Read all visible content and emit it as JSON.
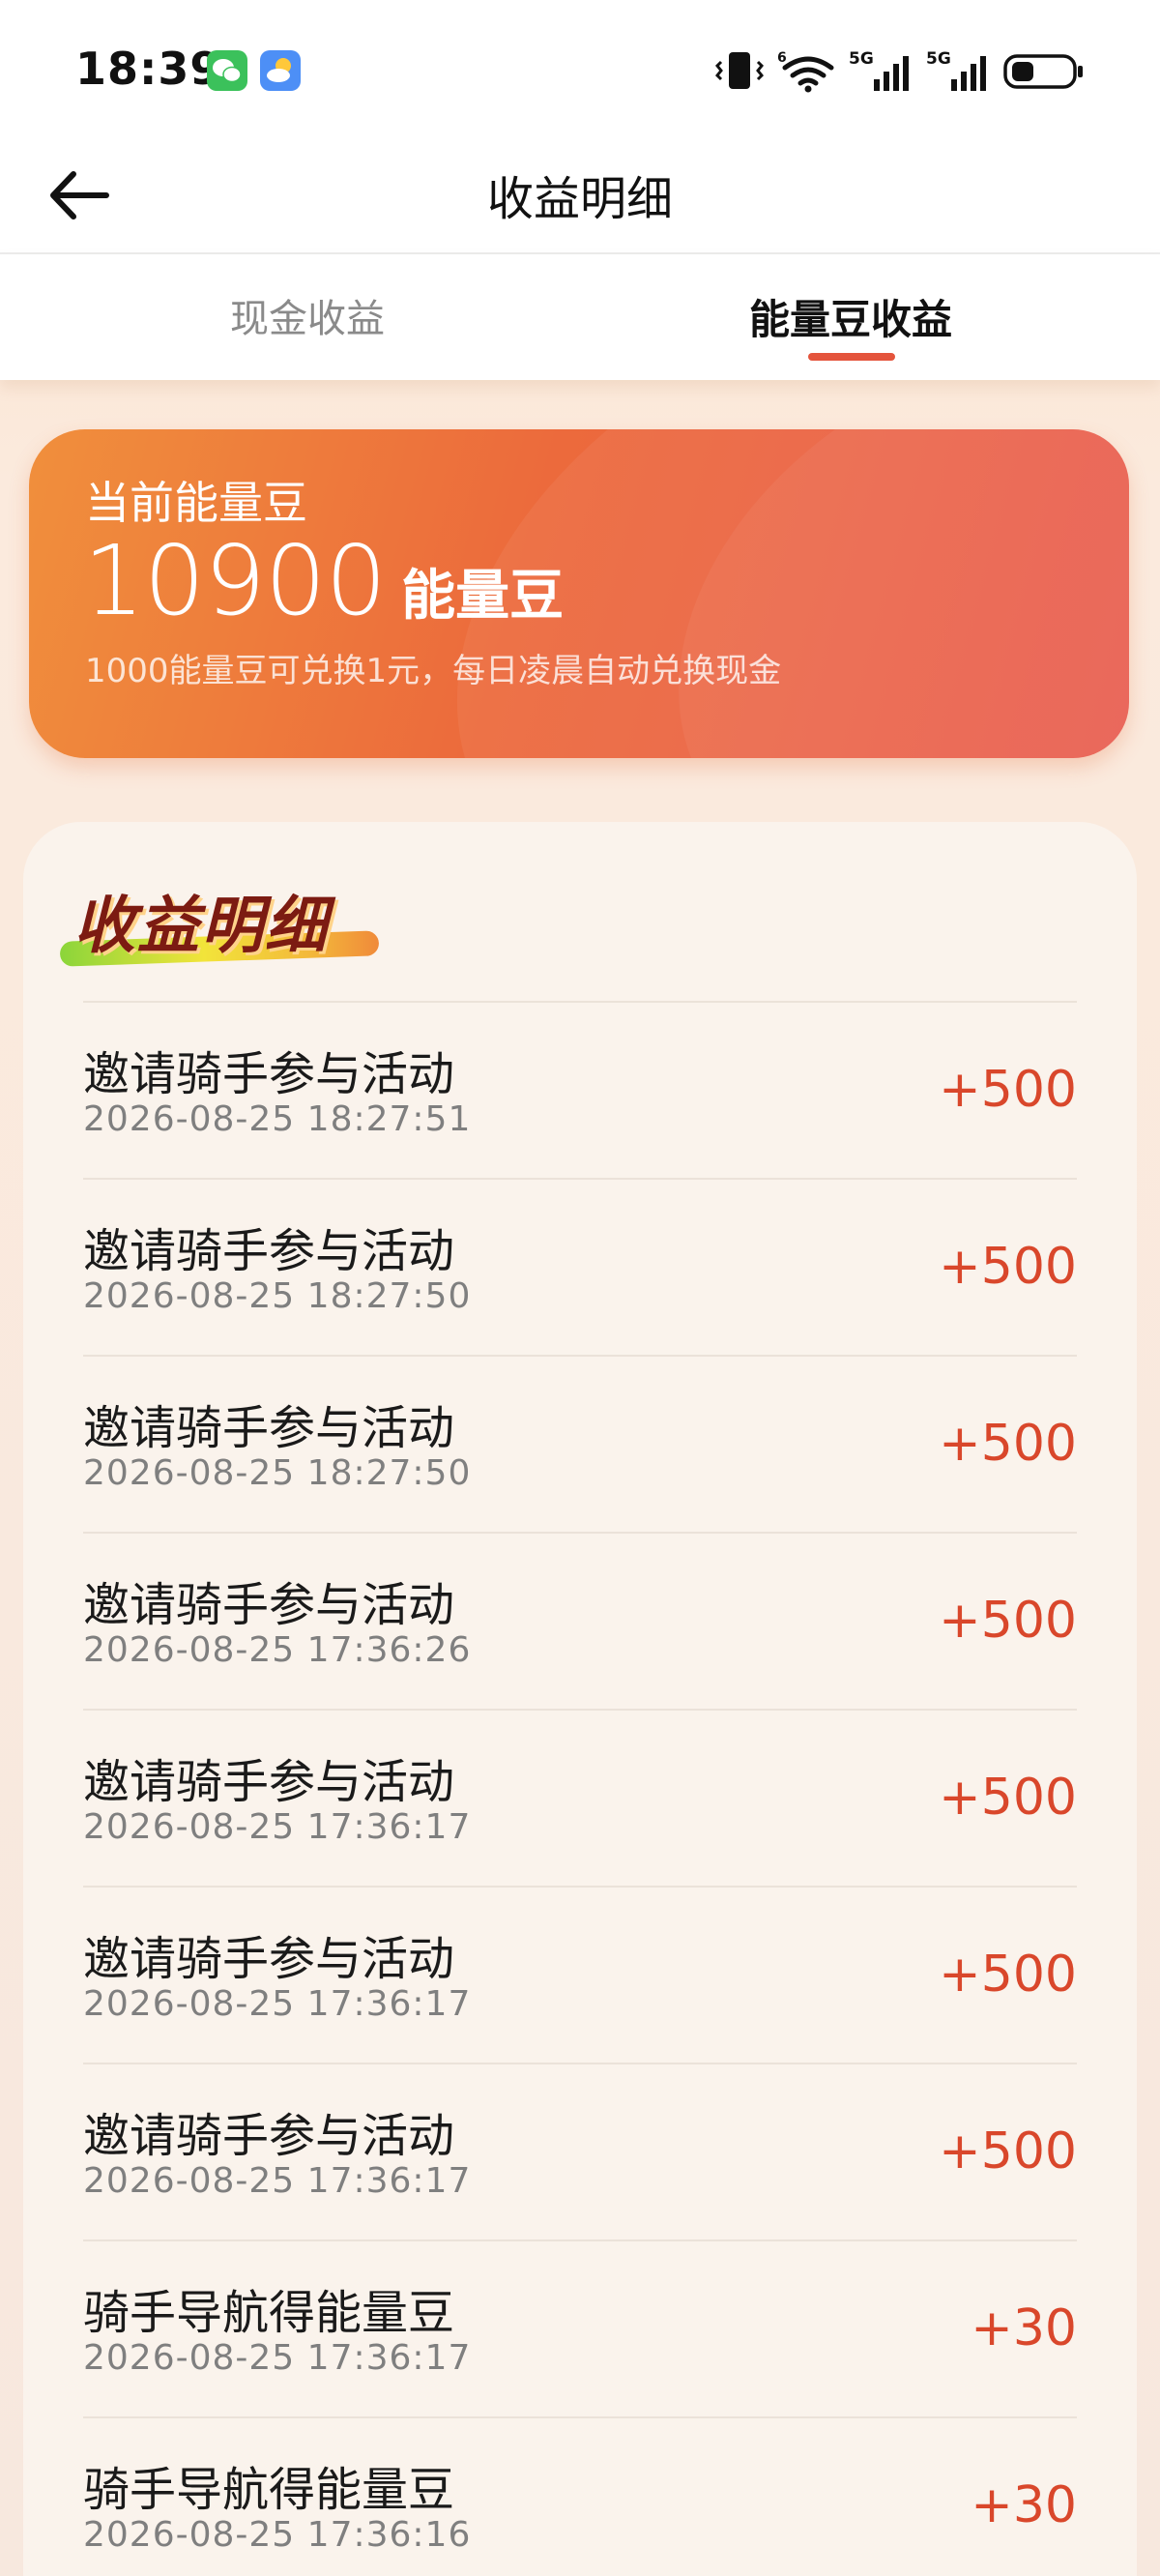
{
  "status_bar": {
    "time": "18:39",
    "apps": [
      "wechat-icon",
      "weather-icon"
    ],
    "icons": [
      "vibrate-icon",
      "wifi-icon",
      "signal-5g-icon",
      "signal-5g-icon",
      "battery-icon"
    ],
    "wifi_badge": "6",
    "network_label_1": "5G",
    "network_label_2": "5G"
  },
  "nav": {
    "title": "收益明细",
    "back_icon": "back-arrow-icon"
  },
  "tabs": [
    {
      "label": "现金收益",
      "active": false
    },
    {
      "label": "能量豆收益",
      "active": true
    }
  ],
  "balance": {
    "label": "当前能量豆",
    "value": "10900",
    "unit": "能量豆",
    "note": "1000能量豆可兑换1元，每日凌晨自动兑换现金"
  },
  "detail": {
    "title": "收益明细",
    "items": [
      {
        "title": "邀请骑手参与活动",
        "time": "2026-08-25 18:27:51",
        "amount": "+500"
      },
      {
        "title": "邀请骑手参与活动",
        "time": "2026-08-25 18:27:50",
        "amount": "+500"
      },
      {
        "title": "邀请骑手参与活动",
        "time": "2026-08-25 18:27:50",
        "amount": "+500"
      },
      {
        "title": "邀请骑手参与活动",
        "time": "2026-08-25 17:36:26",
        "amount": "+500"
      },
      {
        "title": "邀请骑手参与活动",
        "time": "2026-08-25 17:36:17",
        "amount": "+500"
      },
      {
        "title": "邀请骑手参与活动",
        "time": "2026-08-25 17:36:17",
        "amount": "+500"
      },
      {
        "title": "邀请骑手参与活动",
        "time": "2026-08-25 17:36:17",
        "amount": "+500"
      },
      {
        "title": "骑手导航得能量豆",
        "time": "2026-08-25 17:36:17",
        "amount": "+30"
      },
      {
        "title": "骑手导航得能量豆",
        "time": "2026-08-25 17:36:16",
        "amount": "+30"
      }
    ]
  },
  "colors": {
    "accent": "#e4543c",
    "amount": "#d9472b",
    "card_start": "#f08f3c",
    "card_end": "#e8574a"
  }
}
